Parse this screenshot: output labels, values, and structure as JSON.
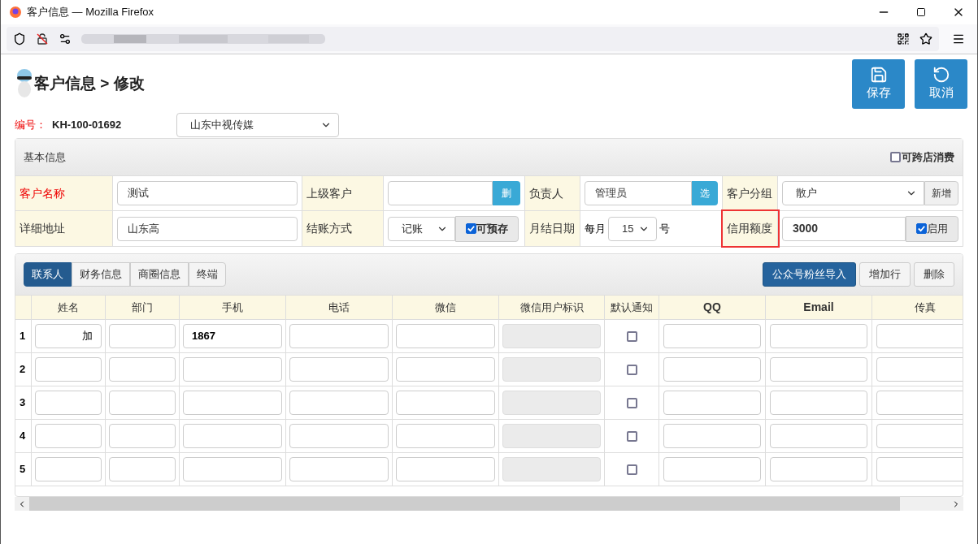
{
  "window": {
    "title": "客户信息 — Mozilla Firefox"
  },
  "page": {
    "breadcrumb": "客户信息 > 修改",
    "buttons": [
      {
        "kind": "save",
        "label": "保存"
      },
      {
        "kind": "cancel",
        "label": "取消"
      }
    ]
  },
  "code": {
    "label": "编号：",
    "value": "KH-100-01692"
  },
  "store_select": {
    "value": "山东中视传媒"
  },
  "basic": {
    "title": "基本信息",
    "cross_store": {
      "label": "可跨店消费",
      "checked": false
    },
    "customer_name": {
      "label": "客户名称",
      "value": "测试"
    },
    "parent_customer": {
      "label": "上级客户",
      "button": "删"
    },
    "owner": {
      "label": "负责人",
      "value": "管理员",
      "button": "选"
    },
    "group": {
      "label": "客户分组",
      "value": "散户",
      "button": "新增"
    },
    "address": {
      "label": "详细地址",
      "value": "山东高"
    },
    "settlement": {
      "label": "结账方式",
      "value": "记账",
      "prepay": {
        "label": "可预存",
        "checked": true
      }
    },
    "billing_day": {
      "label": "月结日期",
      "prefix": "每月",
      "value": "15",
      "suffix": "号"
    },
    "credit": {
      "label": "信用额度",
      "value": "3000",
      "enable": {
        "label": "启用",
        "checked": true
      }
    }
  },
  "tabs": [
    {
      "label": "联系人",
      "selected": true
    },
    {
      "label": "财务信息",
      "selected": false
    },
    {
      "label": "商圈信息",
      "selected": false
    },
    {
      "label": "终端",
      "selected": false
    }
  ],
  "actions": [
    {
      "label": "公众号粉丝导入",
      "kind": "primary"
    },
    {
      "label": "增加行",
      "kind": "default"
    },
    {
      "label": "删除",
      "kind": "default"
    }
  ],
  "table": {
    "columns": [
      "姓名",
      "部门",
      "手机",
      "电话",
      "微信",
      "微信用户标识",
      "默认通知",
      "QQ",
      "Email",
      "传真"
    ],
    "rows": [
      {
        "number": "1",
        "name": "加",
        "mobile": "1867",
        "default_notify": false
      },
      {
        "number": "2",
        "default_notify": false
      },
      {
        "number": "3",
        "default_notify": false
      },
      {
        "number": "4",
        "default_notify": false
      },
      {
        "number": "5",
        "default_notify": false
      }
    ]
  }
}
